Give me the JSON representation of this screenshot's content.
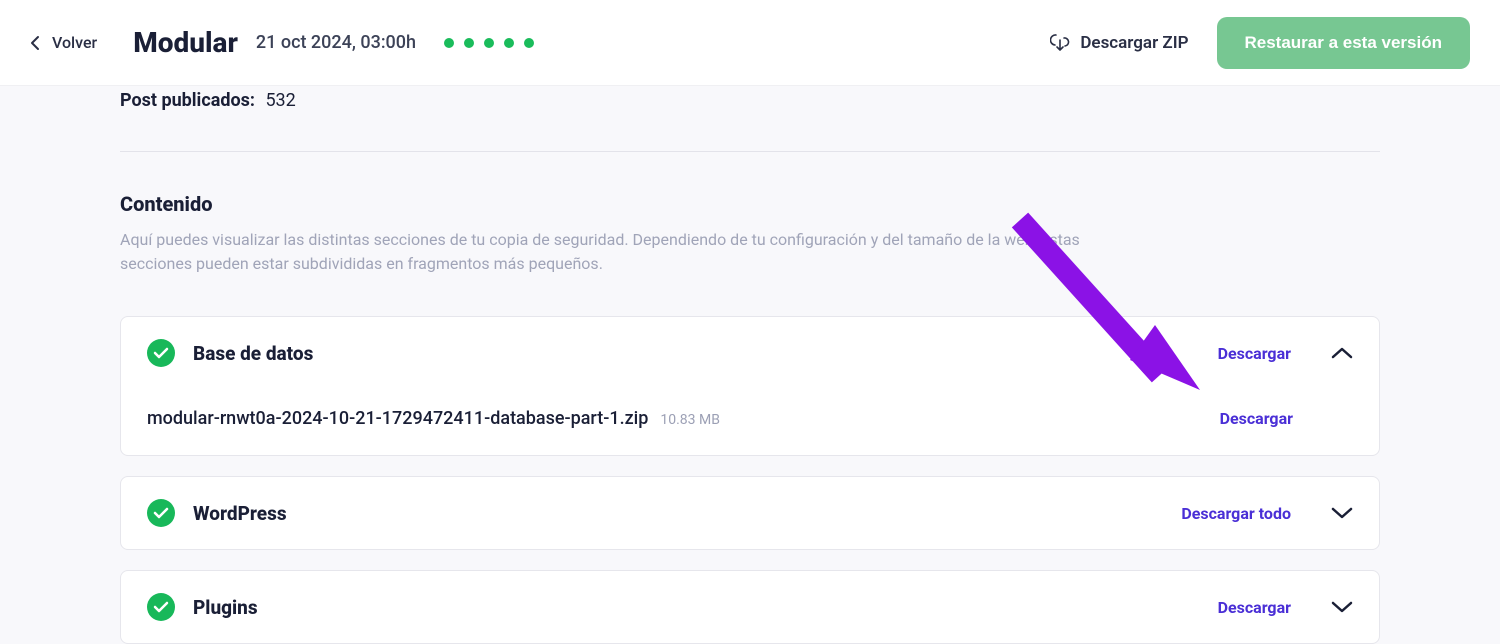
{
  "header": {
    "back_label": "Volver",
    "title": "Modular",
    "datetime": "21 oct 2024, 03:00h",
    "download_zip_label": "Descargar ZIP",
    "restore_label": "Restaurar a esta versión"
  },
  "posts": {
    "label": "Post publicados:",
    "value": "532"
  },
  "content_section": {
    "heading": "Contenido",
    "description": "Aquí puedes visualizar las distintas secciones de tu copia de seguridad. Dependiendo de tu configuración y del tamaño de la web, estas secciones pueden estar subdivididas en fragmentos más pequeños."
  },
  "cards": {
    "database": {
      "title": "Base de datos",
      "download_label": "Descargar",
      "expanded": true,
      "files": [
        {
          "name": "modular-rnwt0a-2024-10-21-1729472411-database-part-1.zip",
          "size": "10.83 MB",
          "download_label": "Descargar"
        }
      ]
    },
    "wordpress": {
      "title": "WordPress",
      "download_label": "Descargar todo",
      "expanded": false
    },
    "plugins": {
      "title": "Plugins",
      "download_label": "Descargar",
      "expanded": false
    }
  },
  "colors": {
    "accent_green": "#18b85a",
    "accent_purple": "#4a2fd6",
    "button_green": "#77c792",
    "arrow_purple": "#8b12e6"
  }
}
